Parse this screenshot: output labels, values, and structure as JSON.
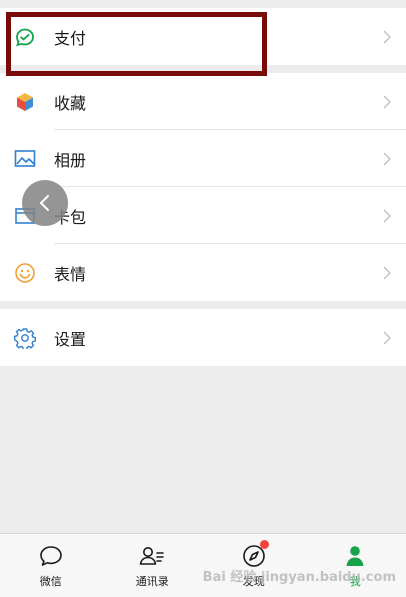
{
  "menu": {
    "pay": "支付",
    "favorites": "收藏",
    "album": "相册",
    "cards": "卡包",
    "stickers": "表情",
    "settings": "设置"
  },
  "tabbar": {
    "chats": "微信",
    "contacts": "通讯录",
    "discover": "发现",
    "me": "我"
  },
  "watermark": "Bai 经验 jingyan.baidu.com",
  "colors": {
    "highlight_border": "#7a0b0b",
    "accent_green": "#16a34a",
    "badge_red": "#f44336"
  }
}
